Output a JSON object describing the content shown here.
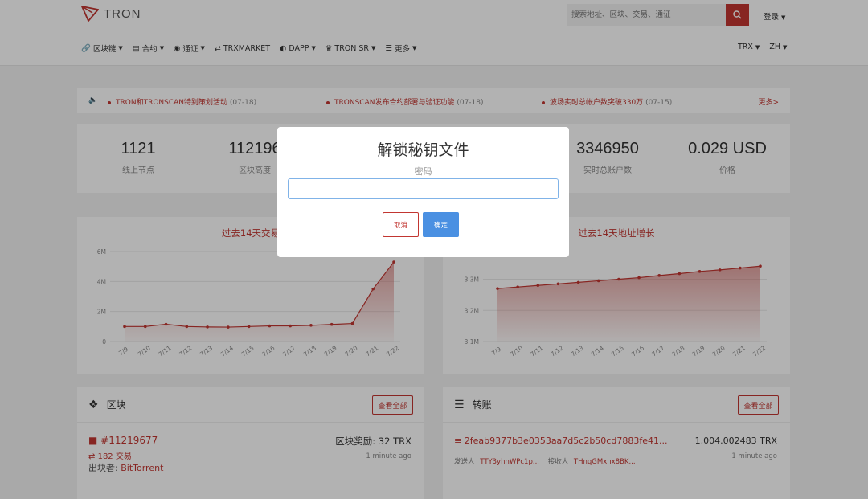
{
  "header": {
    "logo_text": "TRON",
    "search_placeholder": "搜索地址、区块、交易、通证",
    "login_label": "登录",
    "nav": [
      {
        "icon": "link-icon",
        "label": "区块链"
      },
      {
        "icon": "document-icon",
        "label": "合约"
      },
      {
        "icon": "coins-icon",
        "label": "通证"
      },
      {
        "icon": "swap-icon",
        "label": "TRXMARKET"
      },
      {
        "icon": "gamepad-icon",
        "label": "DAPP"
      },
      {
        "icon": "crown-icon",
        "label": "TRON SR"
      },
      {
        "icon": "list-icon",
        "label": "更多"
      }
    ],
    "currency": "TRX",
    "language": "ZH"
  },
  "ticker": {
    "items": [
      {
        "text": "TRON和TRONSCAN特别策划活动",
        "date": "(07-18)"
      },
      {
        "text": "TRONSCAN发布合约部署与验证功能",
        "date": "(07-18)"
      },
      {
        "text": "波场实时总帐户数突破330万",
        "date": "(07-15)"
      }
    ],
    "more": "更多>"
  },
  "stats": [
    {
      "value": "1121",
      "label": "线上节点"
    },
    {
      "value": "112196",
      "label": "区块高度"
    },
    {
      "value": "3346950",
      "label": "实时总账户数"
    },
    {
      "value": "0.029 USD",
      "label": "价格"
    }
  ],
  "charts": {
    "left_title": "过去14天交易",
    "right_title": "过去14天地址增长"
  },
  "chart_data": [
    {
      "type": "area",
      "title": "过去14天交易",
      "categories": [
        "7/9",
        "7/10",
        "7/11",
        "7/12",
        "7/13",
        "7/14",
        "7/15",
        "7/16",
        "7/17",
        "7/18",
        "7/19",
        "7/20",
        "7/21",
        "7/22"
      ],
      "values": [
        1.0,
        1.0,
        1.15,
        1.0,
        0.97,
        0.96,
        1.0,
        1.04,
        1.04,
        1.08,
        1.14,
        1.2,
        3.5,
        5.3
      ],
      "yticks": [
        "0",
        "2M",
        "4M",
        "6M"
      ],
      "ylim": [
        0,
        6
      ]
    },
    {
      "type": "area",
      "title": "过去14天地址增长",
      "categories": [
        "7/9",
        "7/10",
        "7/11",
        "7/12",
        "7/13",
        "7/14",
        "7/15",
        "7/16",
        "7/17",
        "7/18",
        "7/19",
        "7/20",
        "7/21",
        "7/22"
      ],
      "values": [
        3.27,
        3.275,
        3.28,
        3.285,
        3.29,
        3.295,
        3.3,
        3.305,
        3.312,
        3.318,
        3.325,
        3.33,
        3.336,
        3.342
      ],
      "yticks": [
        "3.1M",
        "3.2M",
        "3.3M"
      ],
      "ylim": [
        3.1,
        3.34
      ]
    }
  ],
  "blocks": {
    "title": "区块",
    "view_all": "查看全部",
    "latest": {
      "number": "#11219677",
      "tx_count": "182 交易",
      "producer_label": "出块者:",
      "producer": "BitTorrent",
      "reward": "区块奖励: 32 TRX",
      "time": "1 minute ago"
    }
  },
  "transfers": {
    "title": "转账",
    "view_all": "查看全部",
    "latest": {
      "hash": "2feab9377b3e0353aa7d5c2b50cd7883fe41...",
      "amount": "1,004.002483 TRX",
      "from_label": "发送人",
      "from": "TTY3yhnWPc1p...",
      "to_label": "接收人",
      "to": "THnqGMxnx8BK...",
      "time": "1 minute ago"
    }
  },
  "modal": {
    "title": "解锁秘钥文件",
    "password_label": "密码",
    "password_value": "",
    "cancel_label": "取消",
    "ok_label": "确定"
  },
  "colors": {
    "brand_red": "#c23631",
    "confirm_blue": "#4a90e2"
  }
}
